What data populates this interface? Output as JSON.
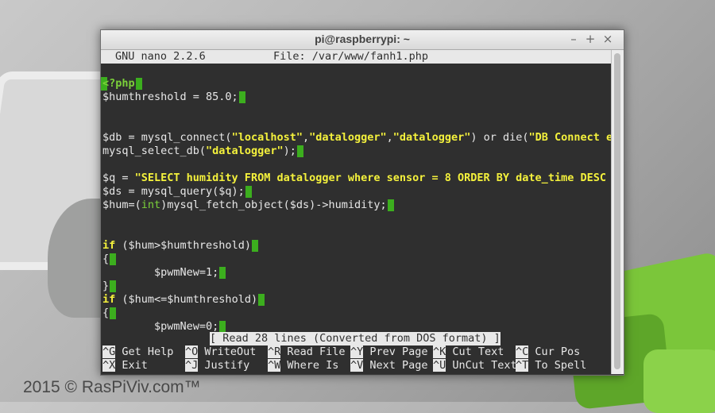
{
  "window": {
    "title": "pi@raspberrypi: ~"
  },
  "header": {
    "app": "GNU nano 2.2.6",
    "file": "File: /var/www/fanh1.php"
  },
  "code": {
    "l1": "<?php",
    "l2": "$humthreshold = 85.0;",
    "l4a": "$db = mysql_connect(",
    "l4b": "\"localhost\"",
    "l4c": ",",
    "l4d": "\"datalogger\"",
    "l4e": ",",
    "l4f": "\"datalogger\"",
    "l4g": ") or die(",
    "l4h": "\"DB Connect e$",
    "l5a": "mysql_select_db(",
    "l5b": "\"datalogger\"",
    "l5c": ");",
    "l7a": "$q = ",
    "l7b": "\"SELECT humidity FROM datalogger where sensor = 8 ORDER BY date_time DESC $",
    "l8": "$ds = mysql_query($q);",
    "l9a": "$hum=(",
    "l9b": "int",
    "l9c": ")mysql_fetch_object($ds)->humidity;",
    "l12a": "if",
    "l12b": " ($hum>$humthreshold)",
    "l13": "{",
    "l14": "        $pwmNew=1;",
    "l15": "}",
    "l16a": "if",
    "l16b": " ($hum<=$humthreshold)",
    "l17": "{",
    "l18": "        $pwmNew=0;"
  },
  "status": "[ Read 28 lines (Converted from DOS format) ]",
  "shortcuts": [
    {
      "key": "^G",
      "label": "Get Help"
    },
    {
      "key": "^O",
      "label": "WriteOut"
    },
    {
      "key": "^R",
      "label": "Read File"
    },
    {
      "key": "^Y",
      "label": "Prev Page"
    },
    {
      "key": "^K",
      "label": "Cut Text"
    },
    {
      "key": "^C",
      "label": "Cur Pos"
    },
    {
      "key": "^X",
      "label": "Exit"
    },
    {
      "key": "^J",
      "label": "Justify"
    },
    {
      "key": "^W",
      "label": "Where Is"
    },
    {
      "key": "^V",
      "label": "Next Page"
    },
    {
      "key": "^U",
      "label": "UnCut Text"
    },
    {
      "key": "^T",
      "label": "To Spell"
    }
  ],
  "watermark": "2015 © RasPiViv.com™",
  "colors": {
    "keyword": "#f4f13c",
    "cursor": "#3cae1e",
    "terminal_bg": "#2f2f2f"
  }
}
